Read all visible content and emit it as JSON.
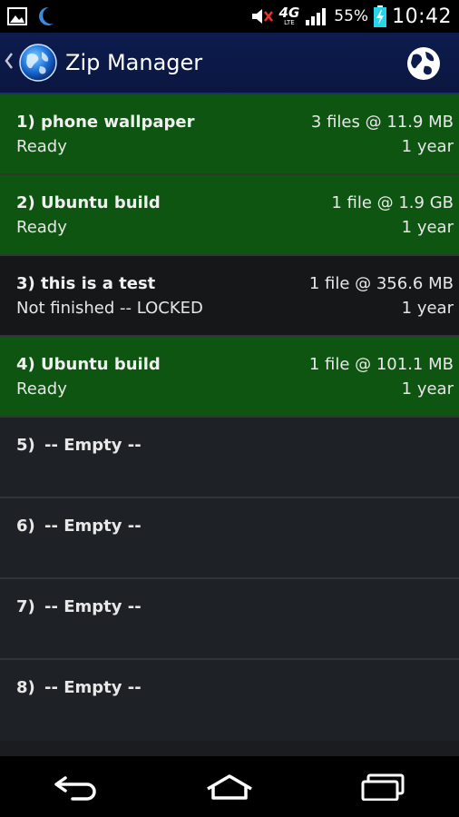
{
  "status_bar": {
    "battery_percent": "55%",
    "time": "10:42",
    "network": "4G",
    "network_sub": "LTE",
    "icons": [
      "image-icon",
      "moon-icon",
      "mute-icon",
      "network-4g-icon",
      "signal-icon",
      "battery-charging-icon"
    ]
  },
  "action_bar": {
    "title": "Zip Manager",
    "icons": [
      "up-caret-icon",
      "app-globe-icon",
      "globe-icon"
    ]
  },
  "slots": [
    {
      "name": "1) phone wallpaper",
      "size": "3 files @ 11.9 MB",
      "status": "Ready",
      "age": "1 year",
      "state": "ready"
    },
    {
      "name": "2) Ubuntu build",
      "size": "1 file @ 1.9 GB",
      "status": "Ready",
      "age": "1 year",
      "state": "ready"
    },
    {
      "name": "3) this is a test",
      "size": "1 file @ 356.6 MB",
      "status": "Not finished -- LOCKED",
      "age": "1 year",
      "state": "notready"
    },
    {
      "name": "4) Ubuntu build",
      "size": "1 file @ 101.1 MB",
      "status": "Ready",
      "age": "1 year",
      "state": "ready"
    },
    {
      "num": "5)",
      "label": "-- Empty --",
      "state": "empty"
    },
    {
      "num": "6)",
      "label": "-- Empty --",
      "state": "empty"
    },
    {
      "num": "7)",
      "label": "-- Empty --",
      "state": "empty"
    },
    {
      "num": "8)",
      "label": "-- Empty --",
      "state": "empty"
    }
  ],
  "nav_bar": {
    "icons": [
      "back-icon",
      "home-icon",
      "recents-icon"
    ]
  },
  "colors": {
    "ready_bg": "#0f5512",
    "notready_bg": "#151719",
    "empty_bg": "#1e2125",
    "actionbar_bg": "#0d1c4e"
  }
}
